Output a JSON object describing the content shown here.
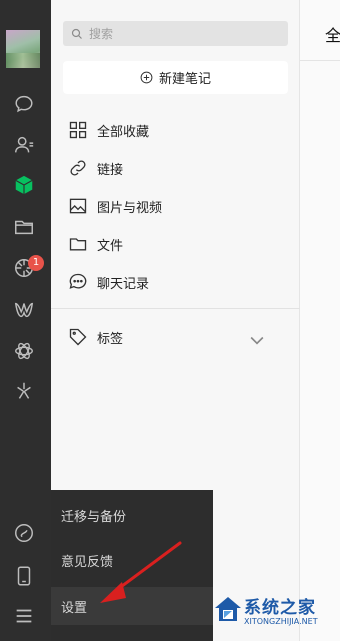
{
  "search": {
    "placeholder": "搜索"
  },
  "panel": {
    "new_note_label": "新建笔记",
    "items": [
      {
        "label": "全部收藏",
        "icon": "grid-icon"
      },
      {
        "label": "链接",
        "icon": "link-icon"
      },
      {
        "label": "图片与视频",
        "icon": "image-icon"
      },
      {
        "label": "文件",
        "icon": "folder-icon"
      },
      {
        "label": "聊天记录",
        "icon": "chat-icon"
      }
    ],
    "tags_label": "标签"
  },
  "rail": {
    "badge_count": "1",
    "icons": [
      "chat-icon",
      "contacts-icon",
      "favorites-cube-icon",
      "folder-icon",
      "moments-icon",
      "channels-icon",
      "mini-program-icon",
      "search-spark-icon",
      "mini-app-icon",
      "phone-icon",
      "menu-icon"
    ]
  },
  "main": {
    "title": "全"
  },
  "popup": {
    "items": [
      {
        "label": "迁移与备份"
      },
      {
        "label": "意见反馈"
      },
      {
        "label": "设置"
      }
    ]
  },
  "watermark": {
    "title": "系统之家",
    "url": "XITONGZHIJIA.NET"
  },
  "colors": {
    "accent_green": "#07c160",
    "badge_red": "#e8534a",
    "arrow_red": "#d9201f",
    "rail_bg": "#2e2e2e"
  }
}
